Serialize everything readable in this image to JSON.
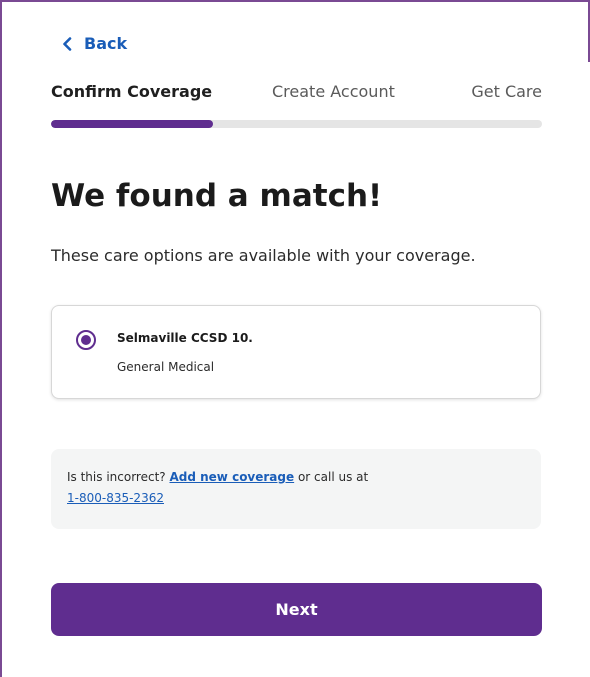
{
  "nav": {
    "back_label": "Back"
  },
  "steps": [
    {
      "label": "Confirm Coverage",
      "active": true
    },
    {
      "label": "Create Account",
      "active": false
    },
    {
      "label": "Get Care",
      "active": false
    }
  ],
  "progress": {
    "fraction": 0.33
  },
  "heading": {
    "title": "We found a match!",
    "subtitle": "These care options are available with your coverage."
  },
  "option": {
    "name": "Selmaville CCSD 10.",
    "type": "General Medical",
    "selected": true
  },
  "info": {
    "prefix": "Is this incorrect?",
    "add_link": "Add new coverage",
    "middle": "or call us at",
    "phone": "1-800-835-2362"
  },
  "actions": {
    "next_label": "Next"
  },
  "colors": {
    "brand": "#5f2d8f",
    "link": "#1a5db8",
    "track": "#e5e5e5",
    "info_bg": "#f4f5f5"
  },
  "icons": {
    "back": "chevron-left-icon"
  }
}
